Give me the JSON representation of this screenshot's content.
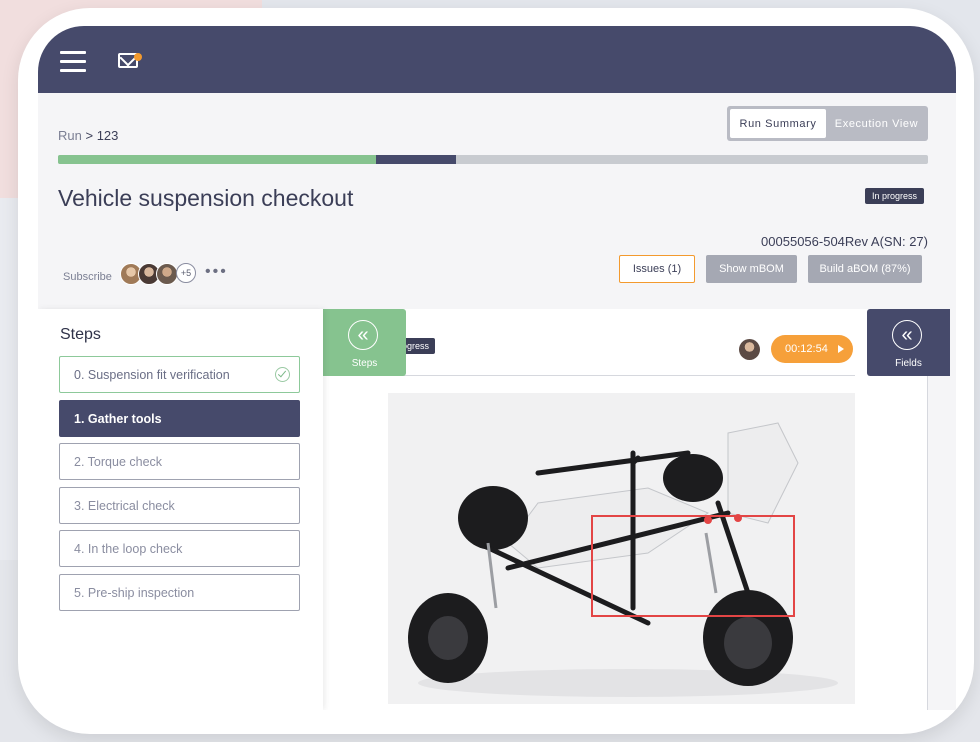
{
  "breadcrumb": {
    "run_label": "Run",
    "separator": ">",
    "run_id": "123"
  },
  "view_toggle": {
    "run_summary_label": "Run Summary",
    "execution_view_label": "Execution View",
    "selected": "Run Summary"
  },
  "progress": {
    "completed_fraction": 0.365,
    "current_fraction": 0.093
  },
  "page_title": "Vehicle suspension checkout",
  "status_badge": "In progress",
  "serial": "00055056-504Rev A(SN: 27)",
  "subscribe": {
    "label": "Subscribe",
    "extra_count": "+5",
    "more_label": "•••"
  },
  "actions": {
    "issues_label": "Issues (1)",
    "show_mbom_label": "Show mBOM",
    "build_abom_label": "Build aBOM (87%)"
  },
  "steps_panel": {
    "title": "Steps",
    "items": [
      {
        "label": "0. Suspension fit verification",
        "state": "done"
      },
      {
        "label": "1. Gather tools",
        "state": "active"
      },
      {
        "label": "2. Torque check",
        "state": "pending"
      },
      {
        "label": "3. Electrical check",
        "state": "pending"
      },
      {
        "label": "4. In the loop check",
        "state": "pending"
      },
      {
        "label": "5. Pre-ship inspection",
        "state": "pending"
      }
    ]
  },
  "steps_toggle": {
    "label": "Steps",
    "icon": "double-chevron-left-icon",
    "chevron": "«"
  },
  "exec_status": "progress",
  "timer": "00:12:54",
  "fields_toggle": {
    "label": "Fields",
    "icon": "double-chevron-left-icon",
    "chevron": "«"
  },
  "colors": {
    "topbar": "#464a6b",
    "green": "#86c38f",
    "orange": "#f39a2e",
    "highlight": "#e34545"
  }
}
